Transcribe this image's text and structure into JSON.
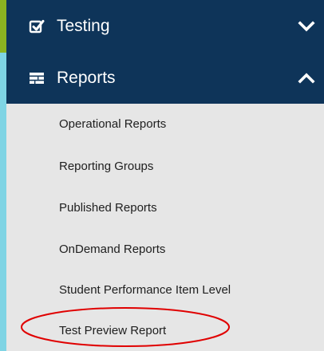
{
  "nav": {
    "testing": {
      "label": "Testing",
      "icon": "checkbox-icon",
      "chevron": "chevron-down-icon",
      "accent_color": "#8bb321"
    },
    "reports": {
      "label": "Reports",
      "icon": "reports-icon",
      "chevron": "chevron-up-icon",
      "accent_color": "#7fd4e4",
      "items": [
        "Operational Reports",
        "Reporting Groups",
        "Published Reports",
        "OnDemand Reports",
        "Student Performance Item Level",
        "Test Preview Report"
      ]
    },
    "header_bg": "#0e3459",
    "submenu_bg": "#e6e6e6",
    "highlight_color": "#e00000"
  }
}
